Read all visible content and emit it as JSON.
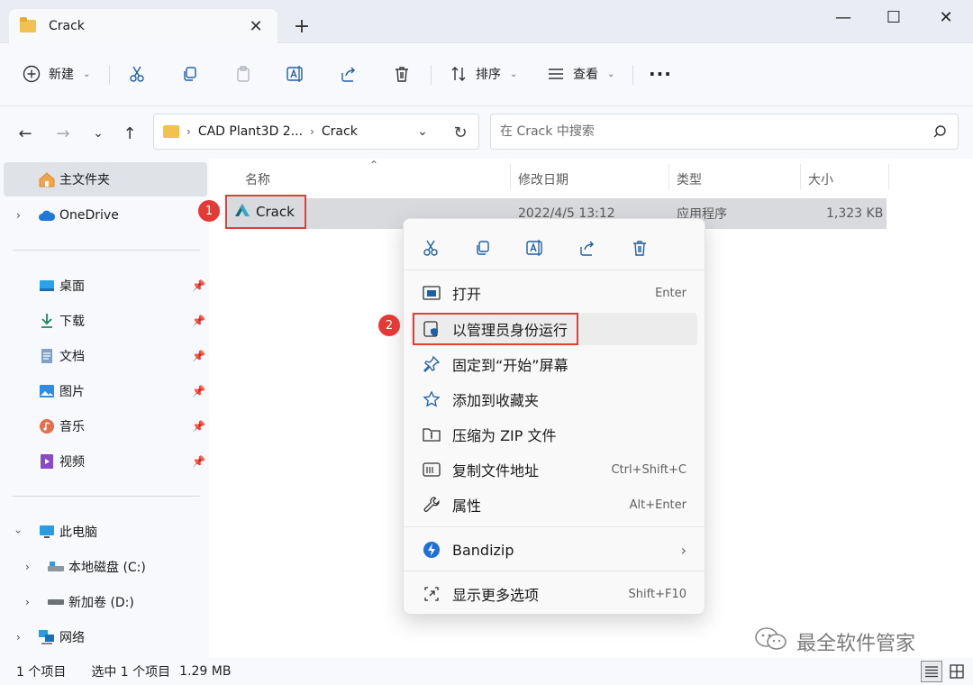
{
  "window": {
    "tab_title": "Crack",
    "tab_close": "✕",
    "new_tab": "+",
    "minimize": "—",
    "maximize": "☐",
    "close": "✕"
  },
  "toolbar": {
    "new_label": "新建",
    "sort_label": "排序",
    "view_label": "查看",
    "more_label": "···",
    "icons": [
      "plus-circle-icon",
      "cut-icon",
      "copy-icon",
      "paste-icon",
      "rename-icon",
      "share-icon",
      "delete-icon",
      "sort-icon",
      "view-icon"
    ]
  },
  "address": {
    "breadcrumb": [
      "CAD Plant3D 2...",
      "Crack"
    ],
    "search_placeholder": "在 Crack 中搜索"
  },
  "sidebar": {
    "home": "主文件夹",
    "onedrive": "OneDrive",
    "quick": [
      {
        "label": "桌面",
        "icon": "desktop-icon"
      },
      {
        "label": "下载",
        "icon": "download-icon"
      },
      {
        "label": "文档",
        "icon": "document-icon"
      },
      {
        "label": "图片",
        "icon": "picture-icon"
      },
      {
        "label": "音乐",
        "icon": "music-icon"
      },
      {
        "label": "视频",
        "icon": "video-icon"
      }
    ],
    "this_pc": "此电脑",
    "drives": [
      "本地磁盘 (C:)",
      "新加卷 (D:)"
    ],
    "network": "网络"
  },
  "columns": {
    "name": "名称",
    "modified": "修改日期",
    "type": "类型",
    "size": "大小"
  },
  "file": {
    "name": "Crack",
    "modified": "2022/4/5 13:12",
    "type": "应用程序",
    "size": "1,323 KB"
  },
  "badges": {
    "one": "1",
    "two": "2"
  },
  "context_menu": {
    "top_icons": [
      "cut-icon",
      "copy-icon",
      "rename-icon",
      "share-icon",
      "delete-icon"
    ],
    "items": [
      {
        "label": "打开",
        "shortcut": "Enter"
      },
      {
        "label": "以管理员身份运行",
        "shortcut": ""
      },
      {
        "label": "固定到“开始”屏幕",
        "shortcut": ""
      },
      {
        "label": "添加到收藏夹",
        "shortcut": ""
      },
      {
        "label": "压缩为 ZIP 文件",
        "shortcut": ""
      },
      {
        "label": "复制文件地址",
        "shortcut": "Ctrl+Shift+C"
      },
      {
        "label": "属性",
        "shortcut": "Alt+Enter"
      },
      {
        "label": "Bandizip",
        "shortcut": "›"
      },
      {
        "label": "显示更多选项",
        "shortcut": "Shift+F10"
      }
    ]
  },
  "status": {
    "count": "1 个项目",
    "selected": "选中 1 个项目",
    "size": "1.29 MB"
  },
  "watermark": "最全软件管家",
  "colors": {
    "accent": "#1e5fa8",
    "highlight_border": "#e0403a",
    "badge": "#e53935"
  }
}
